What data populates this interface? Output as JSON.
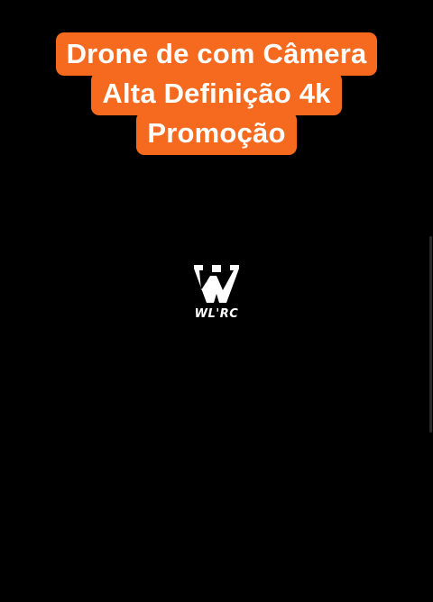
{
  "caption": {
    "lines": [
      "Drone de com Câmera",
      "Alta Definição 4k",
      "Promoção"
    ],
    "background_color": "#f56a1e",
    "text_color": "#ffffff"
  },
  "logo": {
    "text": "WL'RC",
    "icon": "wlrc-logo-icon"
  },
  "colors": {
    "screen_background": "#000000",
    "accent": "#f56a1e"
  }
}
